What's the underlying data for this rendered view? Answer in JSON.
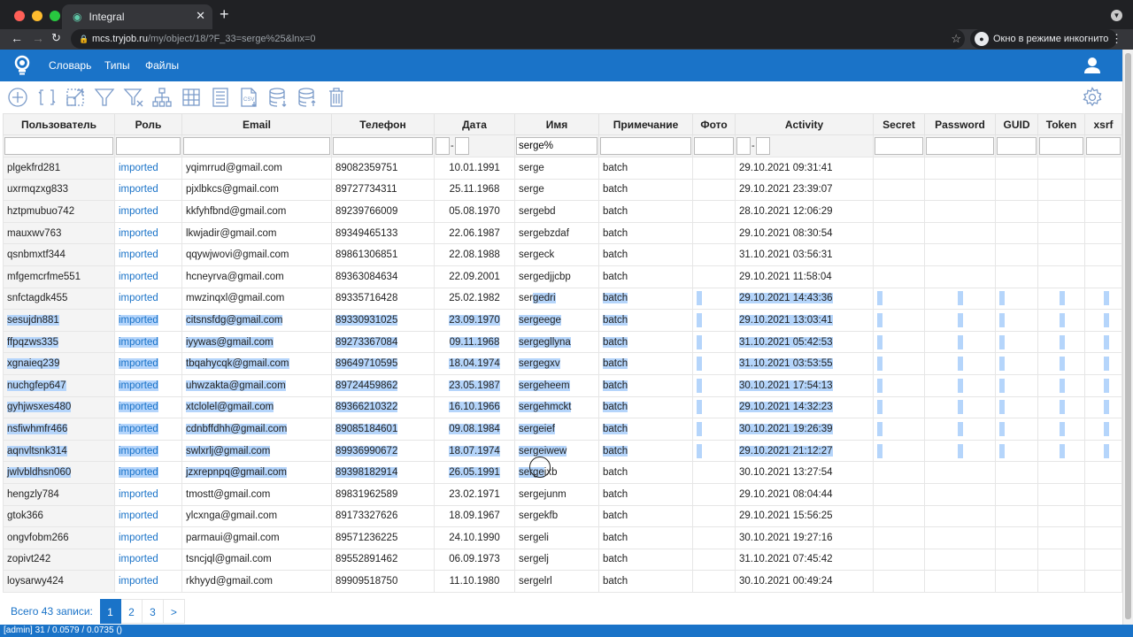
{
  "browser": {
    "tab_title": "Integral",
    "url_host": "mcs.tryjob.ru",
    "url_path": "/my/object/18/?F_33=serge%25&lnx=0",
    "incognito_label": "Окно в режиме инкогнито",
    "traffic_colors": [
      "#ff5f57",
      "#febc2e",
      "#28c840"
    ]
  },
  "app": {
    "accent_color": "#1a73c8",
    "nav": [
      "Словарь",
      "Типы",
      "Файлы"
    ]
  },
  "toolbar": {
    "tools": [
      "add-icon",
      "refresh-icon",
      "expand-icon",
      "filter-icon",
      "clear-filter-icon",
      "hierarchy-icon",
      "grid-icon",
      "list-icon",
      "csv-export-icon",
      "db-download-icon",
      "db-upload-icon",
      "delete-icon"
    ]
  },
  "table": {
    "columns": [
      "Пользователь",
      "Роль",
      "Email",
      "Телефон",
      "Дата",
      "Имя",
      "Примечание",
      "Фото",
      "Activity",
      "Secret",
      "Password",
      "GUID",
      "Token",
      "xsrf"
    ],
    "filters": {
      "name": "serge%"
    },
    "range_dash": "-",
    "rows": [
      {
        "user": "plgekfrd281",
        "role": "imported",
        "email": "yqimrrud@gmail.com",
        "phone": "89082359751",
        "date": "10.01.1991",
        "name": "serge",
        "note": "batch",
        "activity": "29.10.2021 09:31:41",
        "selected": false
      },
      {
        "user": "uxrmqzxg833",
        "role": "imported",
        "email": "pjxlbkcs@gmail.com",
        "phone": "89727734311",
        "date": "25.11.1968",
        "name": "serge",
        "note": "batch",
        "activity": "29.10.2021 23:39:07",
        "selected": false
      },
      {
        "user": "hztpmubuo742",
        "role": "imported",
        "email": "kkfyhfbnd@gmail.com",
        "phone": "89239766009",
        "date": "05.08.1970",
        "name": "sergebd",
        "note": "batch",
        "activity": "28.10.2021 12:06:29",
        "selected": false
      },
      {
        "user": "mauxwv763",
        "role": "imported",
        "email": "lkwjadir@gmail.com",
        "phone": "89349465133",
        "date": "22.06.1987",
        "name": "sergebzdaf",
        "note": "batch",
        "activity": "29.10.2021 08:30:54",
        "selected": false
      },
      {
        "user": "qsnbmxtf344",
        "role": "imported",
        "email": "qqywjwovi@gmail.com",
        "phone": "89861306851",
        "date": "22.08.1988",
        "name": "sergeck",
        "note": "batch",
        "activity": "31.10.2021 03:56:31",
        "selected": false
      },
      {
        "user": "mfgemcrfme551",
        "role": "imported",
        "email": "hcneyrva@gmail.com",
        "phone": "89363084634",
        "date": "22.09.2001",
        "name": "sergedjjcbp",
        "note": "batch",
        "activity": "29.10.2021 11:58:04",
        "selected": false
      },
      {
        "user": "snfctagdk455",
        "role": "imported",
        "email": "mwzinqxl@gmail.com",
        "phone": "89335716428",
        "date": "25.02.1982",
        "name": "sergedri",
        "note": "batch",
        "activity": "29.10.2021 14:43:36",
        "selected": "partial"
      },
      {
        "user": "sesujdn881",
        "role": "imported",
        "email": "citsnsfdg@gmail.com",
        "phone": "89330931025",
        "date": "23.09.1970",
        "name": "sergeege",
        "note": "batch",
        "activity": "29.10.2021 13:03:41",
        "selected": true
      },
      {
        "user": "ffpqzws335",
        "role": "imported",
        "email": "iyywas@gmail.com",
        "phone": "89273367084",
        "date": "09.11.1968",
        "name": "sergegllyna",
        "note": "batch",
        "activity": "31.10.2021 05:42:53",
        "selected": true
      },
      {
        "user": "xgnaieq239",
        "role": "imported",
        "email": "tbqahycqk@gmail.com",
        "phone": "89649710595",
        "date": "18.04.1974",
        "name": "sergegxv",
        "note": "batch",
        "activity": "31.10.2021 03:53:55",
        "selected": true
      },
      {
        "user": "nuchgfep647",
        "role": "imported",
        "email": "uhwzakta@gmail.com",
        "phone": "89724459862",
        "date": "23.05.1987",
        "name": "sergeheem",
        "note": "batch",
        "activity": "30.10.2021 17:54:13",
        "selected": true
      },
      {
        "user": "gyhjwsxes480",
        "role": "imported",
        "email": "xtclolel@gmail.com",
        "phone": "89366210322",
        "date": "16.10.1966",
        "name": "sergehmckt",
        "note": "batch",
        "activity": "29.10.2021 14:32:23",
        "selected": true
      },
      {
        "user": "nsfiwhmfr466",
        "role": "imported",
        "email": "cdnbffdhh@gmail.com",
        "phone": "89085184601",
        "date": "09.08.1984",
        "name": "sergeief",
        "note": "batch",
        "activity": "30.10.2021 19:26:39",
        "selected": true
      },
      {
        "user": "aqnvltsnk314",
        "role": "imported",
        "email": "swlxrlj@gmail.com",
        "phone": "89936990672",
        "date": "18.07.1974",
        "name": "sergeiwew",
        "note": "batch",
        "activity": "29.10.2021 21:12:27",
        "selected": true
      },
      {
        "user": "jwlvbldhsn060",
        "role": "imported",
        "email": "jzxrepnpq@gmail.com",
        "phone": "89398182914",
        "date": "26.05.1991",
        "name": "sergeixb",
        "note": "batch",
        "activity": "30.10.2021 13:27:54",
        "selected": "end"
      },
      {
        "user": "hengzly784",
        "role": "imported",
        "email": "tmostt@gmail.com",
        "phone": "89831962589",
        "date": "23.02.1971",
        "name": "sergejunm",
        "note": "batch",
        "activity": "29.10.2021 08:04:44",
        "selected": false
      },
      {
        "user": "gtok366",
        "role": "imported",
        "email": "ylcxnga@gmail.com",
        "phone": "89173327626",
        "date": "18.09.1967",
        "name": "sergekfb",
        "note": "batch",
        "activity": "29.10.2021 15:56:25",
        "selected": false
      },
      {
        "user": "ongvfobm266",
        "role": "imported",
        "email": "parmaui@gmail.com",
        "phone": "89571236225",
        "date": "24.10.1990",
        "name": "sergeli",
        "note": "batch",
        "activity": "30.10.2021 19:27:16",
        "selected": false
      },
      {
        "user": "zopivt242",
        "role": "imported",
        "email": "tsncjql@gmail.com",
        "phone": "89552891462",
        "date": "06.09.1973",
        "name": "sergelj",
        "note": "batch",
        "activity": "31.10.2021 07:45:42",
        "selected": false
      },
      {
        "user": "loysarwy424",
        "role": "imported",
        "email": "rkhyyd@gmail.com",
        "phone": "89909518750",
        "date": "11.10.1980",
        "name": "sergelrl",
        "note": "batch",
        "activity": "30.10.2021 00:49:24",
        "selected": false
      }
    ]
  },
  "pager": {
    "total_label": "Всего 43 записи:",
    "pages": [
      "1",
      "2",
      "3",
      ">"
    ],
    "current": "1"
  },
  "status_bar": "[admin] 31 / 0.0579 / 0.0735 ()"
}
